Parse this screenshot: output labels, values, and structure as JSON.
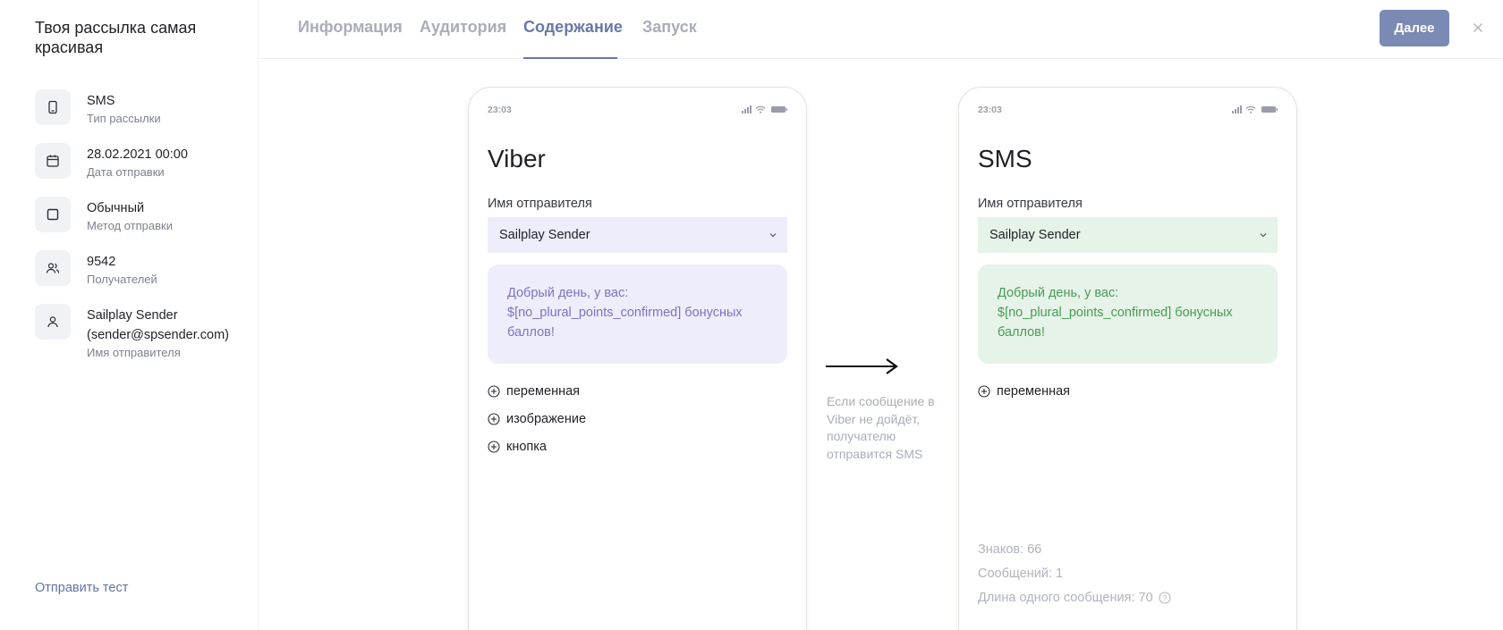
{
  "sidebar": {
    "campaign_title": "Твоя рассылка самая красивая",
    "items": [
      {
        "icon": "phone-icon",
        "value": "SMS",
        "label": "Тип рассылки"
      },
      {
        "icon": "calendar-icon",
        "value": "28.02.2021 00:00",
        "label": "Дата отправки"
      },
      {
        "icon": "square-icon",
        "value": "Обычный",
        "label": "Метод отправки"
      },
      {
        "icon": "users-icon",
        "value": "9542",
        "label": "Получателей"
      },
      {
        "icon": "user-icon",
        "value": "Sailplay Sender (sender@spsender.com)",
        "label": "Имя отправителя"
      }
    ],
    "send_test": "Отправить тест"
  },
  "nav": {
    "tabs": [
      "Информация",
      "Аудитория",
      "Содержание",
      "Запуск"
    ],
    "active_tab": "Содержание",
    "next_label": "Далее"
  },
  "viber": {
    "time": "23:03",
    "title": "Viber",
    "sender_label": "Имя отправителя",
    "sender_value": "Sailplay Sender",
    "message": "Добрый день, у вас: $[no_plural_points_confirmed] бонусных баллов!",
    "add_items": [
      "переменная",
      "изображение",
      "кнопка"
    ]
  },
  "sms": {
    "time": "23:03",
    "title": "SMS",
    "sender_label": "Имя отправителя",
    "sender_value": "Sailplay Sender",
    "message": "Добрый день, у вас: $[no_plural_points_confirmed] бонусных баллов!",
    "add_items": [
      "переменная"
    ],
    "stats": {
      "chars": "Знаков: 66",
      "messages": "Сообщений: 1",
      "length": "Длина одного сообщения: 70"
    }
  },
  "fallback_note": "Если сообщение в Viber не дойдёт, получателю отправится SMS",
  "colors": {
    "accent": "#6878a8",
    "button": "#7b8ab5",
    "viber_bg": "#eeedfb",
    "viber_text": "#7a74c4",
    "sms_bg": "#e6f3e8",
    "sms_text": "#4a9a56"
  }
}
